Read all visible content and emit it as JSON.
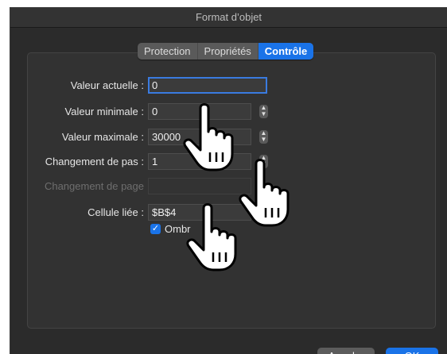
{
  "window": {
    "title": "Format d’objet"
  },
  "tabs": [
    {
      "label": "Protection"
    },
    {
      "label": "Propriétés"
    },
    {
      "label": "Contrôle"
    }
  ],
  "fields": {
    "current": {
      "label": "Valeur actuelle :",
      "value": "0"
    },
    "min": {
      "label": "Valeur minimale :",
      "value": "0"
    },
    "max": {
      "label": "Valeur maximale :",
      "value": "30000"
    },
    "step": {
      "label": "Changement de pas :",
      "value": "1"
    },
    "page": {
      "label": "Changement de page",
      "value": ""
    },
    "cell": {
      "label": "Cellule liée :",
      "value": "$B$4"
    }
  },
  "shading": {
    "label": "Ombr",
    "checked": true
  },
  "buttons": {
    "cancel": "Annuler",
    "ok": "OK"
  },
  "colors": {
    "accent": "#1a73e8",
    "background": "#2b2b2b"
  },
  "icons": [
    "stepper-icon",
    "checkmark-icon",
    "pointer-hand-icon"
  ]
}
